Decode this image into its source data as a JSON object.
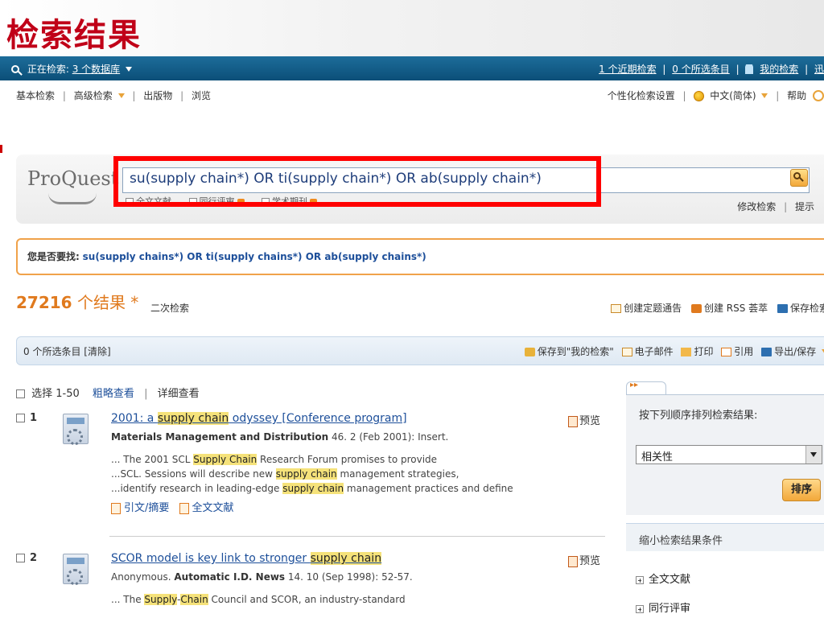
{
  "slide_title": "检索结果",
  "topbar": {
    "searching_in": "正在检索:",
    "databases": "3 个数据库",
    "recent_searches": "1 个近期检索",
    "selected_items": "0 个所选条目",
    "my_research": "我的检索",
    "truncated": "迅"
  },
  "nav": {
    "basic_search": "基本检索",
    "advanced_search": "高级检索",
    "publications": "出版物",
    "browse": "浏览",
    "preferences": "个性化检索设置",
    "language": "中文(简体)",
    "help": "帮助"
  },
  "search": {
    "logo": "ProQuest",
    "query": "su(supply chain*) OR ti(supply chain*) OR ab(supply chain*)",
    "filters": [
      "全文文献",
      "同行评审",
      "学术期刊"
    ],
    "modify": "修改检索",
    "tips": "提示"
  },
  "suggestion": {
    "label": "您是否要找:",
    "query": "su(supply chains*) OR ti(supply chains*) OR ab(supply chains*)"
  },
  "results": {
    "count": "27216",
    "count_suffix": "个结果 *",
    "refine": "二次检索",
    "create_alert": "创建定题通告",
    "create_rss": "创建 RSS 荟萃",
    "save_search": "保存检索"
  },
  "toolbar": {
    "selected": "0 个所选条目 [清除]",
    "save_to_my_research": "保存到\"我的检索\"",
    "email": "电子邮件",
    "print": "打印",
    "cite": "引用",
    "export": "导出/保存"
  },
  "select_row": {
    "select": "选择 1-50",
    "brief_view": "粗略查看",
    "detailed_view": "详细查看"
  },
  "items": [
    {
      "index": "1",
      "title_pre": "2001: a ",
      "title_hl": "supply chain",
      "title_post": " odyssey [Conference program]",
      "source_journal": "Materials Management and Distribution",
      "source_rest": " 46. 2  (Feb 2001): Insert.",
      "snippet1_pre": "... The 2001 SCL ",
      "snippet1_hl": "Supply Chain",
      "snippet1_post": " Research Forum promises to provide",
      "snippet2_pre": "...SCL. Sessions will describe new ",
      "snippet2_hl": "supply chain",
      "snippet2_post": " management strategies,",
      "snippet3_pre": "...identify research in leading-edge ",
      "snippet3_hl": "supply chain",
      "snippet3_post": " management practices and define",
      "link_abstract": "引文/摘要",
      "link_fulltext": "全文文献",
      "preview": "预览"
    },
    {
      "index": "2",
      "title_pre": "SCOR model is key link to stronger ",
      "title_hl": "supply chain",
      "author": "Anonymous. ",
      "source_journal": "Automatic I.D. News",
      "source_rest": " 14. 10  (Sep 1998): 52-57.",
      "snippet1_pre": "... The ",
      "snippet1_hl_a": "Supply",
      "snippet1_mid": "-",
      "snippet1_hl_b": "Chain",
      "snippet1_post": " Council and SCOR, an industry-standard",
      "preview": "预览"
    }
  ],
  "sidebar": {
    "sort_label": "按下列顺序排列检索结果:",
    "sort_value": "相关性",
    "sort_button": "排序",
    "narrow_header": "缩小检索结果条件",
    "narrow_items": [
      "全文文献",
      "同行评审"
    ]
  }
}
